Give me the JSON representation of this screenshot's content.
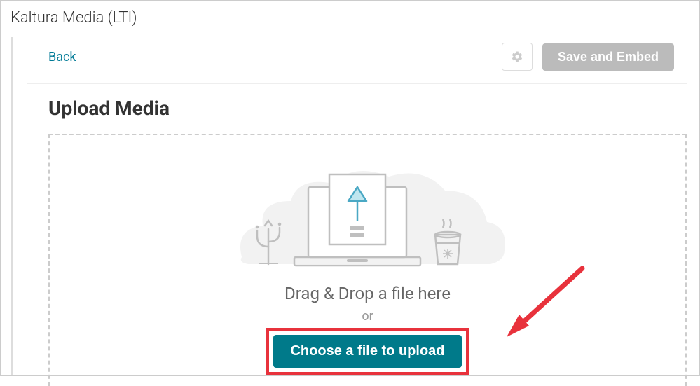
{
  "app": {
    "title": "Kaltura Media (LTI)"
  },
  "toolbar": {
    "back_label": "Back",
    "settings_icon": "gear-icon",
    "save_embed_label": "Save and Embed"
  },
  "page": {
    "heading": "Upload Media"
  },
  "dropzone": {
    "drag_drop_text": "Drag & Drop a file here",
    "or_text": "or",
    "choose_button_label": "Choose a file to upload"
  },
  "annotation": {
    "arrow_color": "#e8323c"
  }
}
